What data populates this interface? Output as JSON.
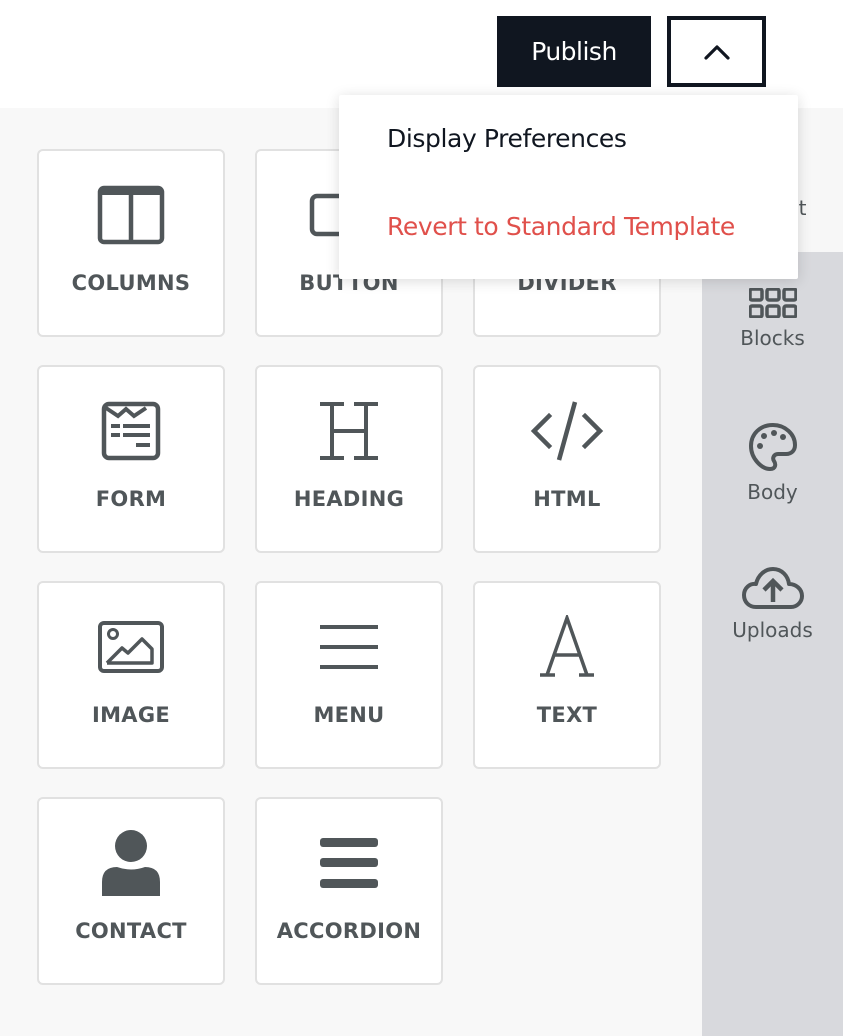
{
  "header": {
    "publish_label": "Publish",
    "toggle_icon": "chevron-up-icon"
  },
  "dropdown": {
    "items": [
      {
        "label": "Display Preferences",
        "color": "#101620"
      },
      {
        "label": "Revert to Standard Template",
        "color": "#e0504b"
      }
    ]
  },
  "sidebar": {
    "tabs": [
      {
        "label": "Content",
        "visible_text": "nt",
        "active": true
      },
      {
        "label": "Blocks",
        "icon": "grid-icon"
      },
      {
        "label": "Body",
        "icon": "palette-icon"
      },
      {
        "label": "Uploads",
        "icon": "cloud-upload-icon"
      }
    ]
  },
  "blocks": [
    {
      "label": "COLUMNS",
      "icon": "columns-icon"
    },
    {
      "label": "BUTTON",
      "icon": "button-icon"
    },
    {
      "label": "DIVIDER",
      "icon": "divider-icon"
    },
    {
      "label": "FORM",
      "icon": "form-icon"
    },
    {
      "label": "HEADING",
      "icon": "heading-icon"
    },
    {
      "label": "HTML",
      "icon": "code-icon"
    },
    {
      "label": "IMAGE",
      "icon": "image-icon"
    },
    {
      "label": "MENU",
      "icon": "menu-icon"
    },
    {
      "label": "TEXT",
      "icon": "text-icon"
    },
    {
      "label": "CONTACT",
      "icon": "user-icon"
    },
    {
      "label": "ACCORDION",
      "icon": "accordion-icon"
    }
  ],
  "colors": {
    "primary_dark": "#101620",
    "danger": "#e0504b",
    "icon_gray": "#505659",
    "sidebar_bg": "#d8d9dd",
    "content_bg": "#f8f8f8"
  }
}
